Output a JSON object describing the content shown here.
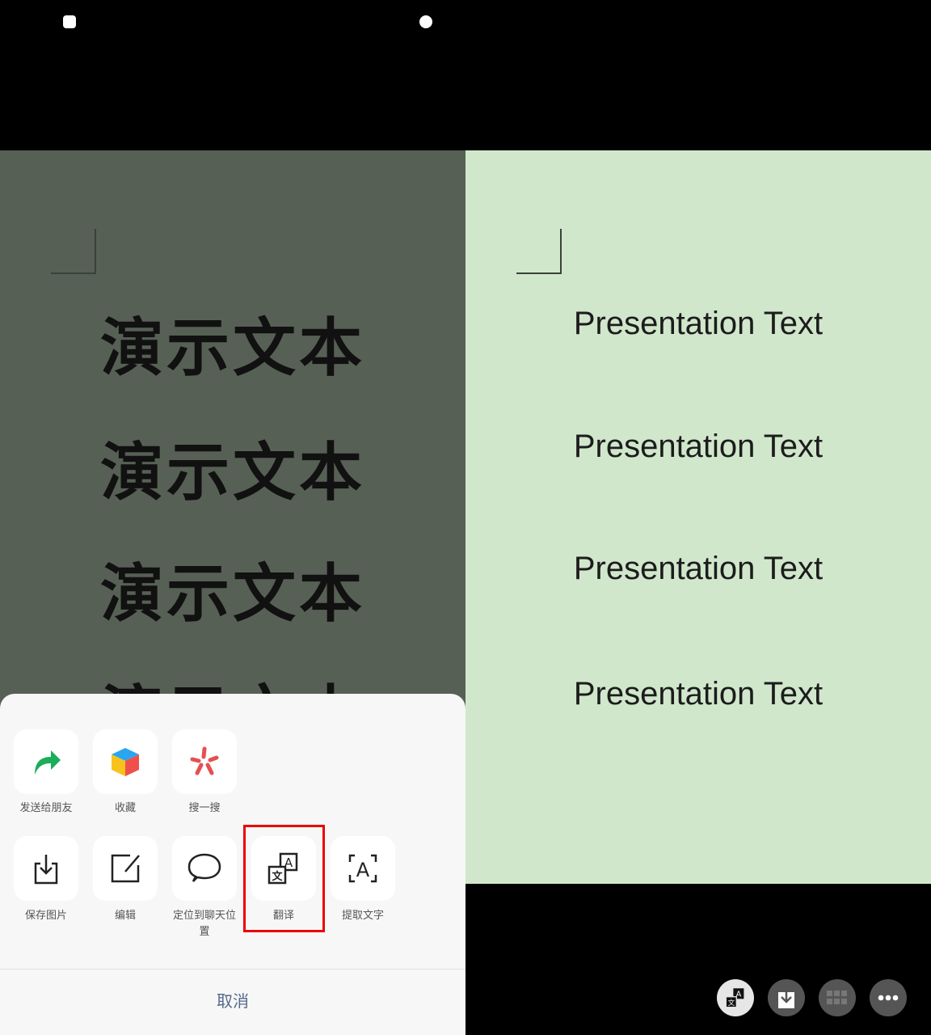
{
  "source_text": [
    "演示文本",
    "演示文本",
    "演示文本",
    "演示文本"
  ],
  "translated_text": [
    "Presentation Text",
    "Presentation Text",
    "Presentation Text",
    "Presentation Text"
  ],
  "sheet": {
    "row1": [
      {
        "label": "发送给朋友",
        "icon": "share-arrow-icon"
      },
      {
        "label": "收藏",
        "icon": "favorite-cube-icon"
      },
      {
        "label": "搜一搜",
        "icon": "search-star-icon"
      }
    ],
    "row2": [
      {
        "label": "保存图片",
        "icon": "save-image-icon"
      },
      {
        "label": "编辑",
        "icon": "edit-icon"
      },
      {
        "label": "定位到聊天位置",
        "icon": "chat-bubble-icon"
      },
      {
        "label": "翻译",
        "icon": "translate-icon",
        "highlighted": true
      },
      {
        "label": "提取文字",
        "icon": "extract-text-icon"
      }
    ],
    "cancel": "取消"
  },
  "bottom_buttons": [
    "translate-icon",
    "download-icon",
    "grid-icon",
    "more-icon"
  ],
  "colors": {
    "highlight": "#e00000",
    "left_bg": "#576055",
    "right_bg": "#d1e7cc"
  }
}
